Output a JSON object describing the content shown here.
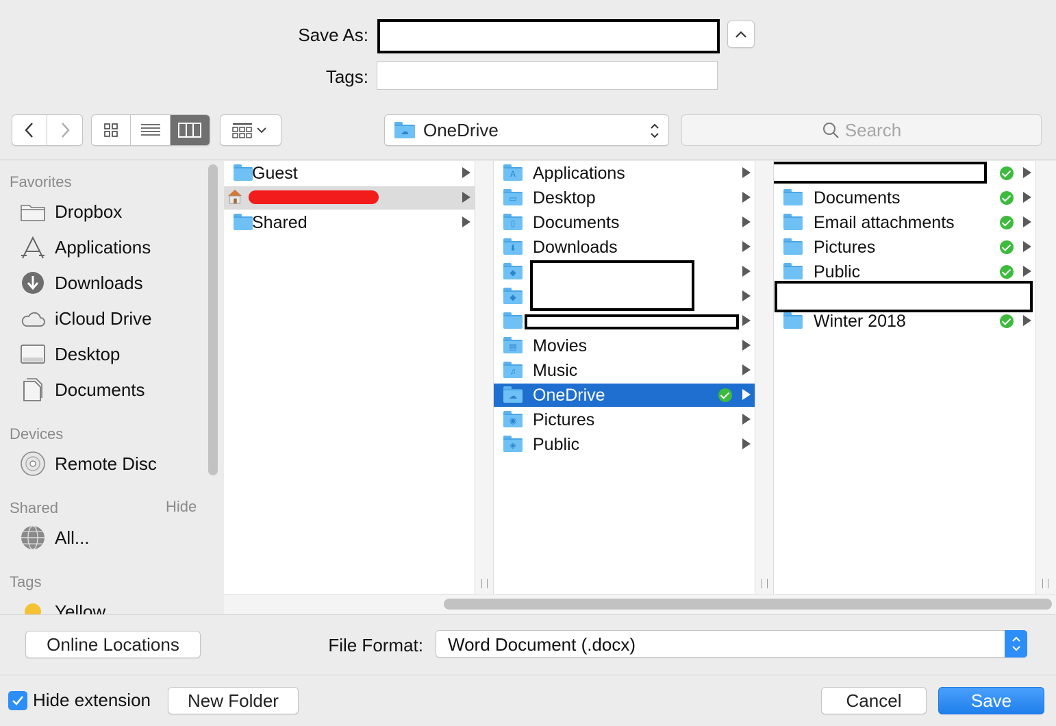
{
  "top": {
    "save_as_label": "Save As:",
    "save_as_value": "",
    "tags_label": "Tags:",
    "tags_value": ""
  },
  "toolbar": {
    "location": "OneDrive",
    "search_placeholder": "Search"
  },
  "sidebar": {
    "favorites_title": "Favorites",
    "favorites": [
      "Dropbox",
      "Applications",
      "Downloads",
      "iCloud Drive",
      "Desktop",
      "Documents"
    ],
    "devices_title": "Devices",
    "devices": [
      "Remote Disc"
    ],
    "shared_title": "Shared",
    "shared_hide": "Hide",
    "shared": [
      "All..."
    ],
    "tags_title": "Tags",
    "tags": [
      "Yellow"
    ]
  },
  "column1": [
    "Guest",
    "",
    "Shared"
  ],
  "column2": [
    "Applications",
    "Desktop",
    "Documents",
    "Downloads",
    "",
    "",
    "",
    "Movies",
    "Music",
    "OneDrive",
    "Pictures",
    "Public"
  ],
  "column3": [
    "",
    "Documents",
    "Email attachments",
    "Pictures",
    "Public",
    "",
    "Winter 2018"
  ],
  "bottom": {
    "online_locations": "Online Locations",
    "file_format_label": "File Format:",
    "file_format_value": "Word Document (.docx)",
    "hide_extension": "Hide extension",
    "new_folder": "New Folder",
    "cancel": "Cancel",
    "save": "Save"
  },
  "colors": {
    "selection": "#1f6fd0",
    "save_button": "#2e8ef7",
    "sync_check": "#3dbb3d",
    "folder": "#6ec0f5"
  }
}
